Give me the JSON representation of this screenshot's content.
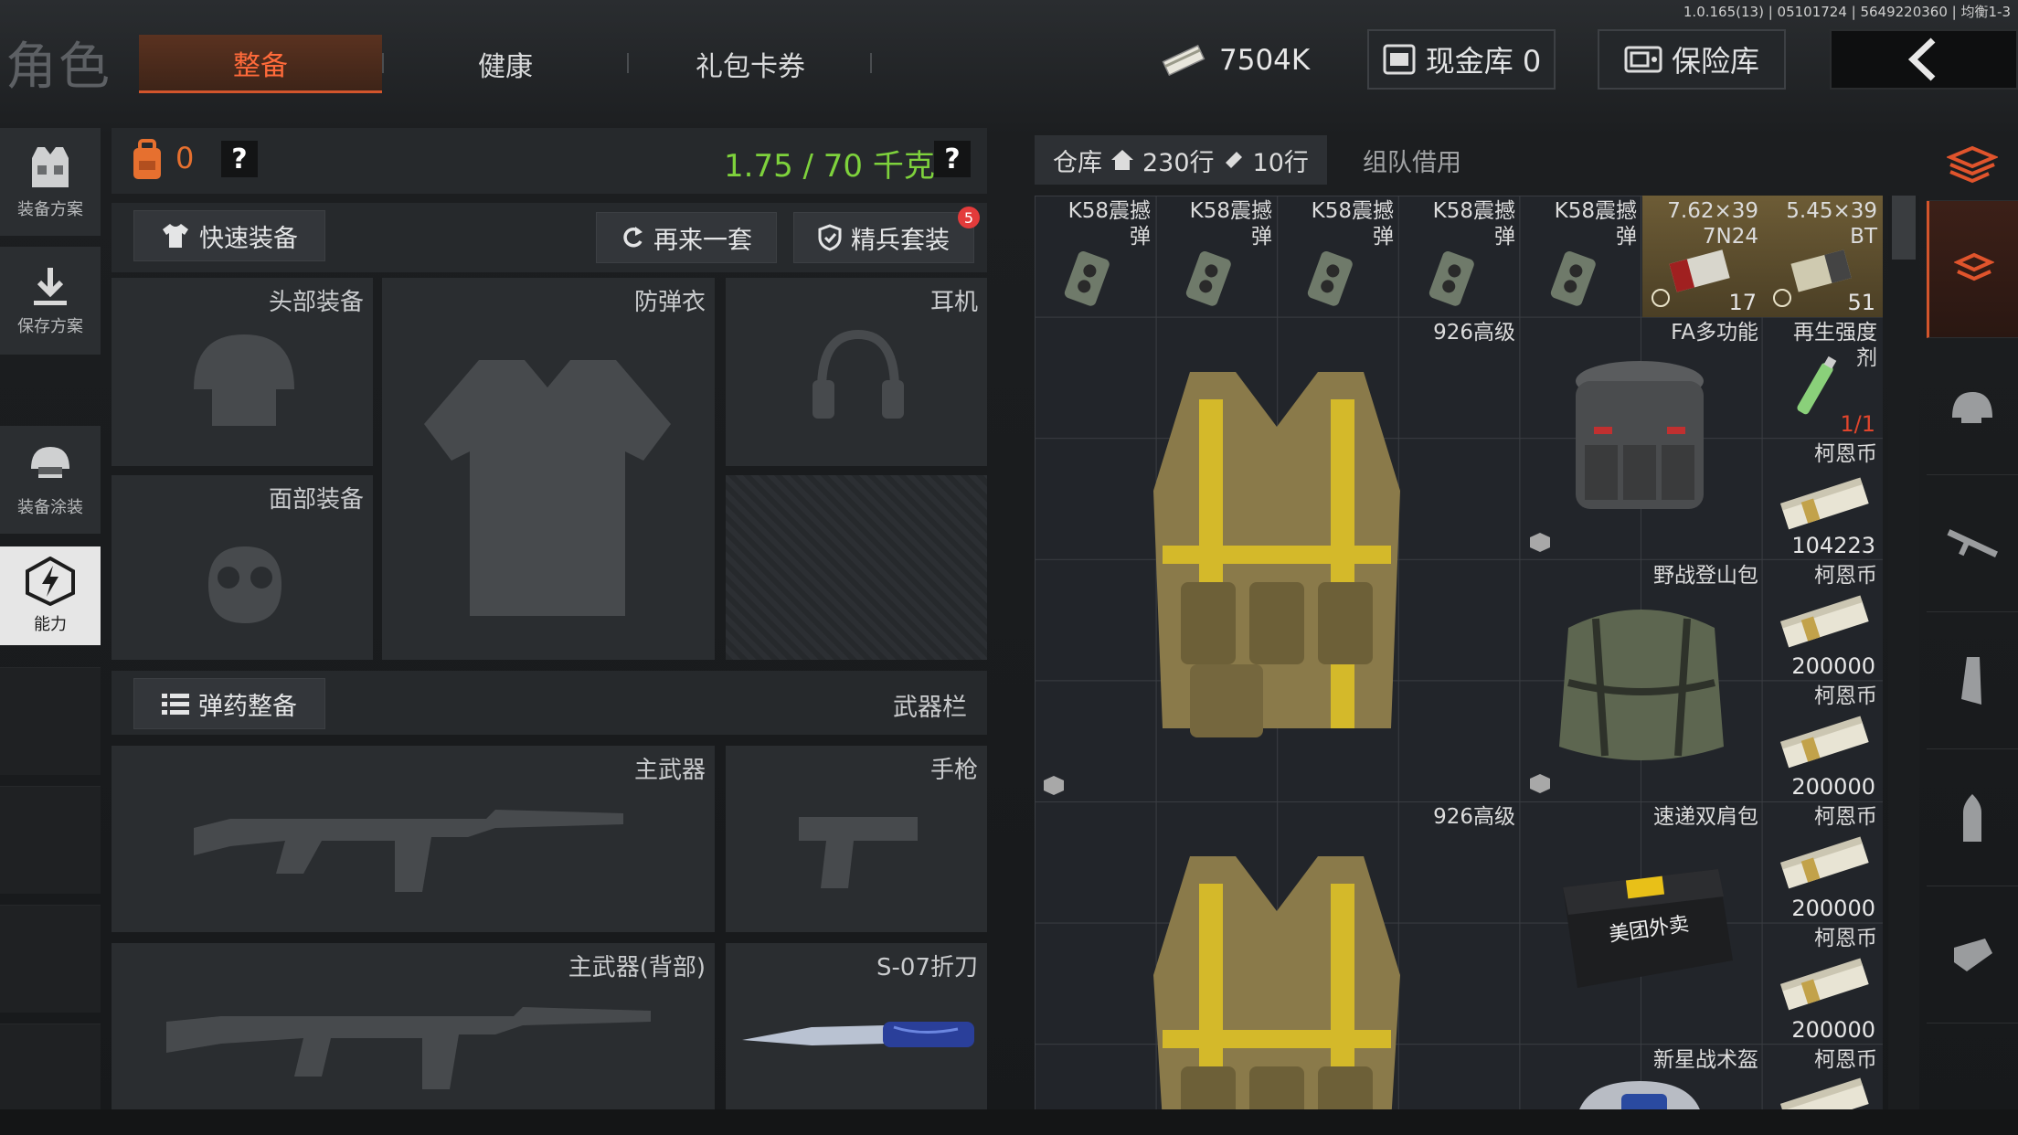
{
  "version": "1.0.165(13) | 05101724 | 5649220360 | 均衡1-3",
  "header": {
    "title": "角色",
    "tabs": [
      {
        "label": "整备",
        "active": true
      },
      {
        "label": "健康",
        "active": false
      },
      {
        "label": "礼包卡券",
        "active": false
      }
    ],
    "money": "7504K",
    "cash_vault": "现金库 0",
    "safe_box": "保险库"
  },
  "left_nav": [
    {
      "label": "装备方案",
      "icon": "vest-icon"
    },
    {
      "label": "保存方案",
      "icon": "download-icon"
    },
    {
      "label": "装备涂装",
      "icon": "helmet-icon"
    },
    {
      "label": "能力",
      "icon": "ability-icon",
      "active": true
    }
  ],
  "loadout": {
    "backpack_count": "0",
    "help": "?",
    "weight": "1.75 / 70 千克",
    "quick_equip": "快速装备",
    "another_set": "再来一套",
    "elite_set": "精兵套装",
    "elite_badge": "5",
    "slots": {
      "head": "头部装备",
      "armor": "防弹衣",
      "headset": "耳机",
      "face": "面部装备",
      "ammo_button": "弹药整备",
      "weapon_bar": "武器栏",
      "primary": "主武器",
      "pistol": "手枪",
      "primary_back": "主武器(背部)",
      "knife": "S-07折刀"
    }
  },
  "warehouse": {
    "tab_label": "仓库",
    "rows": "230行",
    "extra_rows": "10行",
    "team_borrow": "组队借用",
    "items": {
      "k58": "K58震撼弹",
      "ammo1_name": "7.62×39 7N24",
      "ammo1_count": "17",
      "ammo2_name": "5.45×39 BT",
      "ammo2_count": "51",
      "vest1": "926高级",
      "fa_bag": "FA多功能",
      "regen_name": "再生强度剂",
      "regen_count": "1/1",
      "coin": "柯恩币",
      "coin1": "104223",
      "field_bag": "野战登山包",
      "coin2": "200000",
      "coin3": "200000",
      "vest2": "926高级",
      "express_bag": "速递双肩包",
      "delivery_text": "美团外卖",
      "coin4": "200000",
      "coin5": "200000",
      "helmet": "新星战术盔"
    }
  },
  "colors": {
    "accent": "#ff6a3a",
    "weight_green": "#7ed23c",
    "badge_red": "#e33b3b"
  }
}
